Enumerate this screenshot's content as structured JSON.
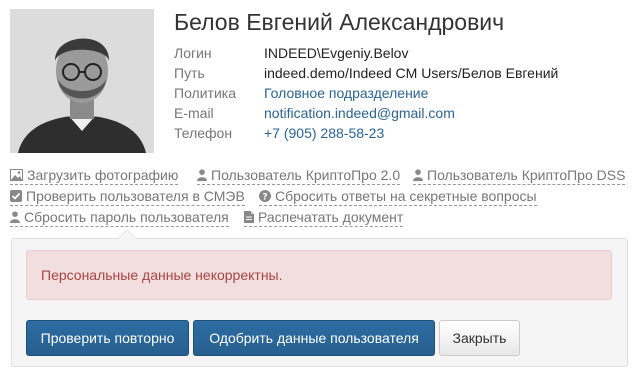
{
  "user": {
    "full_name": "Белов Евгений Александрович",
    "fields": [
      {
        "label": "Логин",
        "value": "INDEED\\Evgeniy.Belov",
        "link": false
      },
      {
        "label": "Путь",
        "value": "indeed.demo/Indeed CM Users/Белов Евгений",
        "link": false
      },
      {
        "label": "Политика",
        "value": "Головное подразделение",
        "link": true
      },
      {
        "label": "E-mail",
        "value": "notification.indeed@gmail.com",
        "link": true
      },
      {
        "label": "Телефон",
        "value": "+7 (905) 288-58-23",
        "link": true
      }
    ]
  },
  "actions": [
    {
      "label": "Загрузить фотографию",
      "icon": "image-icon"
    },
    {
      "label": "Пользователь КриптоПро 2.0",
      "icon": "user-icon"
    },
    {
      "label": "Пользователь КриптоПро DSS",
      "icon": "user-icon"
    },
    {
      "label": "Проверить пользователя в СМЭВ",
      "icon": "check-square-icon"
    },
    {
      "label": "Сбросить ответы на секретные вопросы",
      "icon": "question-circle-icon"
    },
    {
      "label": "Сбросить пароль пользователя",
      "icon": "user-icon"
    },
    {
      "label": "Распечатать документ",
      "icon": "document-icon"
    }
  ],
  "alert": {
    "message": "Персональные данные некорректны."
  },
  "buttons": {
    "retry": "Проверить повторно",
    "approve": "Одобрить данные пользователя",
    "close": "Закрыть"
  },
  "colors": {
    "link": "#2a6496",
    "primary": "#2d6ca2",
    "alert_bg": "#f2dede",
    "alert_text": "#a94442"
  }
}
